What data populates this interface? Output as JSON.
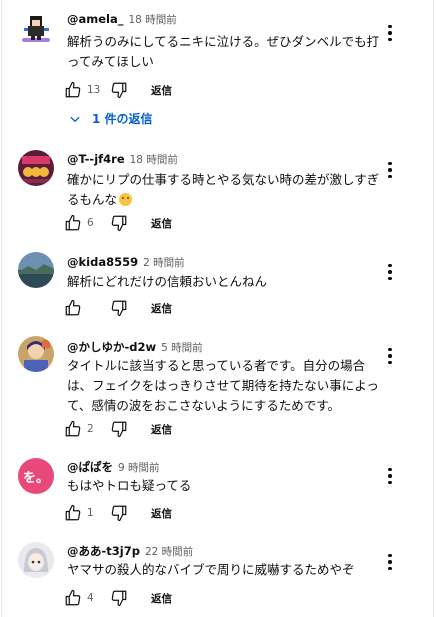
{
  "comments": [
    {
      "author": "@amela_",
      "time": "18 時間前",
      "text": "解析うのみにしてるニキに泣ける。ぜひダンベルでも打ってみてほしい",
      "likes": "13",
      "reply_label": "返信",
      "avatar": "pixel-character-icon",
      "replies_label": "1 件の返信"
    },
    {
      "author": "@T--jf4re",
      "time": "18 時間前",
      "text": "確かにリプの仕事する時とやる気ない時の差が激しすぎるもんな",
      "emoji": "grimacing-face",
      "likes": "6",
      "reply_label": "返信",
      "avatar": "slot-machine-icon"
    },
    {
      "author": "@kida8559",
      "time": "2 時間前",
      "text": "解析にどれだけの信頼おいとんねん",
      "likes": "",
      "reply_label": "返信",
      "avatar": "landscape-photo-icon"
    },
    {
      "author": "@かしゆか-d2w",
      "time": "5 時間前",
      "text": "タイトルに該当すると思っている者です。自分の場合は、フェイクをはっきりさせて期待を持たない事によって、感情の波をおこさないようにするためです。",
      "likes": "2",
      "reply_label": "返信",
      "avatar": "anime-character-icon"
    },
    {
      "author": "@ぱぱを",
      "time": "9 時間前",
      "text": "もはやトロも疑ってる",
      "likes": "1",
      "reply_label": "返信",
      "avatar": "letter-avatar",
      "avatar_letter": "を。",
      "avatar_color": "#e8497a"
    },
    {
      "author": "@ああ-t3j7p",
      "time": "22 時間前",
      "text": "ヤマサの殺人的なバイブで周りに威嚇するためやぞ",
      "likes": "4",
      "reply_label": "返信",
      "avatar": "anime-girl-icon"
    }
  ],
  "colors": {
    "link": "#065fd4",
    "muted": "#606060",
    "text": "#0f0f0f"
  }
}
